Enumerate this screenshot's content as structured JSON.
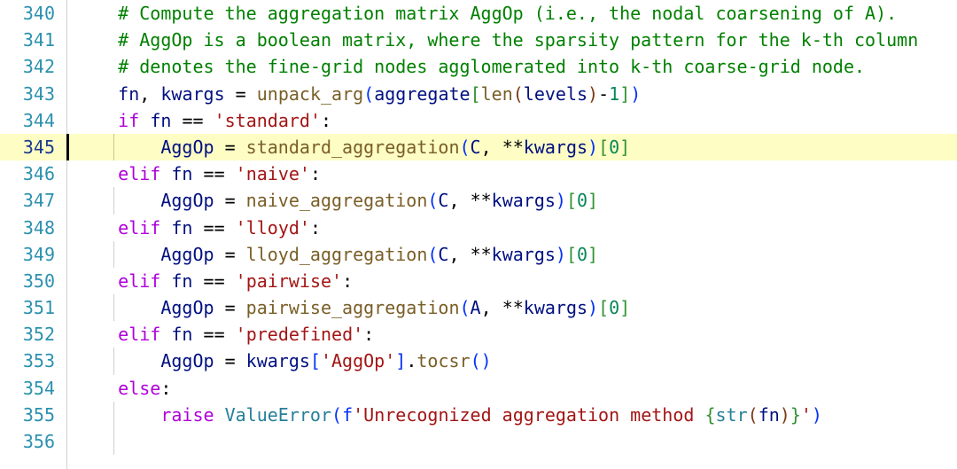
{
  "editor": {
    "name": "code-editor-pane",
    "language": "Python",
    "active_line": 345,
    "highlight_color": "#fdfdc4",
    "background_color": "#ffffff",
    "gutter_color": "#2b91af",
    "first_visible_line": 340,
    "last_visible_line": 356,
    "theme_colors": {
      "comment": "#008000",
      "keyword": "#af00db",
      "variable": "#001080",
      "function": "#795e26",
      "string": "#a31515",
      "number": "#098658",
      "class": "#267f99",
      "bracket_level_1": "#0431fa",
      "bracket_level_2": "#319331",
      "bracket_level_3": "#7b3814"
    }
  },
  "lines": [
    {
      "number": "340",
      "indent_guides": 0,
      "active": false,
      "text": "    # Compute the aggregation matrix AggOp (i.e., the nodal coarsening of A)."
    },
    {
      "number": "341",
      "indent_guides": 0,
      "active": false,
      "text": "    # AggOp is a boolean matrix, where the sparsity pattern for the k-th column"
    },
    {
      "number": "342",
      "indent_guides": 0,
      "active": false,
      "text": "    # denotes the fine-grid nodes agglomerated into k-th coarse-grid node."
    },
    {
      "number": "343",
      "indent_guides": 0,
      "active": false,
      "text": "    fn, kwargs = unpack_arg(aggregate[len(levels)-1])"
    },
    {
      "number": "344",
      "indent_guides": 0,
      "active": false,
      "text": "    if fn == 'standard':"
    },
    {
      "number": "345",
      "indent_guides": 1,
      "active": true,
      "text": "        AggOp = standard_aggregation(C, **kwargs)[0]"
    },
    {
      "number": "346",
      "indent_guides": 0,
      "active": false,
      "text": "    elif fn == 'naive':"
    },
    {
      "number": "347",
      "indent_guides": 1,
      "active": false,
      "text": "        AggOp = naive_aggregation(C, **kwargs)[0]"
    },
    {
      "number": "348",
      "indent_guides": 0,
      "active": false,
      "text": "    elif fn == 'lloyd':"
    },
    {
      "number": "349",
      "indent_guides": 1,
      "active": false,
      "text": "        AggOp = lloyd_aggregation(C, **kwargs)[0]"
    },
    {
      "number": "350",
      "indent_guides": 0,
      "active": false,
      "text": "    elif fn == 'pairwise':"
    },
    {
      "number": "351",
      "indent_guides": 1,
      "active": false,
      "text": "        AggOp = pairwise_aggregation(A, **kwargs)[0]"
    },
    {
      "number": "352",
      "indent_guides": 0,
      "active": false,
      "text": "    elif fn == 'predefined':"
    },
    {
      "number": "353",
      "indent_guides": 1,
      "active": false,
      "text": "        AggOp = kwargs['AggOp'].tocsr()"
    },
    {
      "number": "354",
      "indent_guides": 0,
      "active": false,
      "text": "    else:"
    },
    {
      "number": "355",
      "indent_guides": 1,
      "active": false,
      "text": "        raise ValueError(f'Unrecognized aggregation method {str(fn)}')"
    },
    {
      "number": "356",
      "indent_guides": 1,
      "active": false,
      "text": ""
    }
  ],
  "tokens": [
    [
      {
        "c": "t-com",
        "s": "    # Compute the aggregation matrix AggOp (i.e., the nodal coarsening of A)."
      }
    ],
    [
      {
        "c": "t-com",
        "s": "    # AggOp is a boolean matrix, where the sparsity pattern for the k-th column"
      }
    ],
    [
      {
        "c": "t-com",
        "s": "    # denotes the fine-grid nodes agglomerated into k-th coarse-grid node."
      }
    ],
    [
      {
        "c": "t-op",
        "s": "    "
      },
      {
        "c": "t-var",
        "s": "fn"
      },
      {
        "c": "t-op",
        "s": ", "
      },
      {
        "c": "t-var",
        "s": "kwargs"
      },
      {
        "c": "t-op",
        "s": " = "
      },
      {
        "c": "t-fn",
        "s": "unpack_arg"
      },
      {
        "c": "t-b1",
        "s": "("
      },
      {
        "c": "t-var",
        "s": "aggregate"
      },
      {
        "c": "t-b2",
        "s": "["
      },
      {
        "c": "t-fn",
        "s": "len"
      },
      {
        "c": "t-b3",
        "s": "("
      },
      {
        "c": "t-var",
        "s": "levels"
      },
      {
        "c": "t-b3",
        "s": ")"
      },
      {
        "c": "t-op",
        "s": "-"
      },
      {
        "c": "t-num",
        "s": "1"
      },
      {
        "c": "t-b2",
        "s": "]"
      },
      {
        "c": "t-b1",
        "s": ")"
      }
    ],
    [
      {
        "c": "t-op",
        "s": "    "
      },
      {
        "c": "t-kw",
        "s": "if"
      },
      {
        "c": "t-op",
        "s": " "
      },
      {
        "c": "t-var",
        "s": "fn"
      },
      {
        "c": "t-op",
        "s": " == "
      },
      {
        "c": "t-str",
        "s": "'standard'"
      },
      {
        "c": "t-op",
        "s": ":"
      }
    ],
    [
      {
        "c": "t-op",
        "s": "        "
      },
      {
        "c": "t-var",
        "s": "AggOp"
      },
      {
        "c": "t-op",
        "s": " = "
      },
      {
        "c": "t-fn",
        "s": "standard_aggregation"
      },
      {
        "c": "t-b1",
        "s": "("
      },
      {
        "c": "t-var",
        "s": "C"
      },
      {
        "c": "t-op",
        "s": ", "
      },
      {
        "c": "t-op",
        "s": "**"
      },
      {
        "c": "t-var",
        "s": "kwargs"
      },
      {
        "c": "t-b1",
        "s": ")"
      },
      {
        "c": "t-b2",
        "s": "["
      },
      {
        "c": "t-num",
        "s": "0"
      },
      {
        "c": "t-b2",
        "s": "]"
      }
    ],
    [
      {
        "c": "t-op",
        "s": "    "
      },
      {
        "c": "t-kw",
        "s": "elif"
      },
      {
        "c": "t-op",
        "s": " "
      },
      {
        "c": "t-var",
        "s": "fn"
      },
      {
        "c": "t-op",
        "s": " == "
      },
      {
        "c": "t-str",
        "s": "'naive'"
      },
      {
        "c": "t-op",
        "s": ":"
      }
    ],
    [
      {
        "c": "t-op",
        "s": "        "
      },
      {
        "c": "t-var",
        "s": "AggOp"
      },
      {
        "c": "t-op",
        "s": " = "
      },
      {
        "c": "t-fn",
        "s": "naive_aggregation"
      },
      {
        "c": "t-b1",
        "s": "("
      },
      {
        "c": "t-var",
        "s": "C"
      },
      {
        "c": "t-op",
        "s": ", "
      },
      {
        "c": "t-op",
        "s": "**"
      },
      {
        "c": "t-var",
        "s": "kwargs"
      },
      {
        "c": "t-b1",
        "s": ")"
      },
      {
        "c": "t-b2",
        "s": "["
      },
      {
        "c": "t-num",
        "s": "0"
      },
      {
        "c": "t-b2",
        "s": "]"
      }
    ],
    [
      {
        "c": "t-op",
        "s": "    "
      },
      {
        "c": "t-kw",
        "s": "elif"
      },
      {
        "c": "t-op",
        "s": " "
      },
      {
        "c": "t-var",
        "s": "fn"
      },
      {
        "c": "t-op",
        "s": " == "
      },
      {
        "c": "t-str",
        "s": "'lloyd'"
      },
      {
        "c": "t-op",
        "s": ":"
      }
    ],
    [
      {
        "c": "t-op",
        "s": "        "
      },
      {
        "c": "t-var",
        "s": "AggOp"
      },
      {
        "c": "t-op",
        "s": " = "
      },
      {
        "c": "t-fn",
        "s": "lloyd_aggregation"
      },
      {
        "c": "t-b1",
        "s": "("
      },
      {
        "c": "t-var",
        "s": "C"
      },
      {
        "c": "t-op",
        "s": ", "
      },
      {
        "c": "t-op",
        "s": "**"
      },
      {
        "c": "t-var",
        "s": "kwargs"
      },
      {
        "c": "t-b1",
        "s": ")"
      },
      {
        "c": "t-b2",
        "s": "["
      },
      {
        "c": "t-num",
        "s": "0"
      },
      {
        "c": "t-b2",
        "s": "]"
      }
    ],
    [
      {
        "c": "t-op",
        "s": "    "
      },
      {
        "c": "t-kw",
        "s": "elif"
      },
      {
        "c": "t-op",
        "s": " "
      },
      {
        "c": "t-var",
        "s": "fn"
      },
      {
        "c": "t-op",
        "s": " == "
      },
      {
        "c": "t-str",
        "s": "'pairwise'"
      },
      {
        "c": "t-op",
        "s": ":"
      }
    ],
    [
      {
        "c": "t-op",
        "s": "        "
      },
      {
        "c": "t-var",
        "s": "AggOp"
      },
      {
        "c": "t-op",
        "s": " = "
      },
      {
        "c": "t-fn",
        "s": "pairwise_aggregation"
      },
      {
        "c": "t-b1",
        "s": "("
      },
      {
        "c": "t-var",
        "s": "A"
      },
      {
        "c": "t-op",
        "s": ", "
      },
      {
        "c": "t-op",
        "s": "**"
      },
      {
        "c": "t-var",
        "s": "kwargs"
      },
      {
        "c": "t-b1",
        "s": ")"
      },
      {
        "c": "t-b2",
        "s": "["
      },
      {
        "c": "t-num",
        "s": "0"
      },
      {
        "c": "t-b2",
        "s": "]"
      }
    ],
    [
      {
        "c": "t-op",
        "s": "    "
      },
      {
        "c": "t-kw",
        "s": "elif"
      },
      {
        "c": "t-op",
        "s": " "
      },
      {
        "c": "t-var",
        "s": "fn"
      },
      {
        "c": "t-op",
        "s": " == "
      },
      {
        "c": "t-str",
        "s": "'predefined'"
      },
      {
        "c": "t-op",
        "s": ":"
      }
    ],
    [
      {
        "c": "t-op",
        "s": "        "
      },
      {
        "c": "t-var",
        "s": "AggOp"
      },
      {
        "c": "t-op",
        "s": " = "
      },
      {
        "c": "t-var",
        "s": "kwargs"
      },
      {
        "c": "t-b1",
        "s": "["
      },
      {
        "c": "t-str",
        "s": "'AggOp'"
      },
      {
        "c": "t-b1",
        "s": "]"
      },
      {
        "c": "t-op",
        "s": "."
      },
      {
        "c": "t-fn",
        "s": "tocsr"
      },
      {
        "c": "t-b1",
        "s": "()"
      }
    ],
    [
      {
        "c": "t-op",
        "s": "    "
      },
      {
        "c": "t-kw",
        "s": "else"
      },
      {
        "c": "t-op",
        "s": ":"
      }
    ],
    [
      {
        "c": "t-op",
        "s": "        "
      },
      {
        "c": "t-kw",
        "s": "raise"
      },
      {
        "c": "t-op",
        "s": " "
      },
      {
        "c": "t-cls",
        "s": "ValueError"
      },
      {
        "c": "t-b1",
        "s": "("
      },
      {
        "c": "t-b1",
        "s": "f"
      },
      {
        "c": "t-str",
        "s": "'Unrecognized aggregation method "
      },
      {
        "c": "t-b2",
        "s": "{"
      },
      {
        "c": "t-cls",
        "s": "str"
      },
      {
        "c": "t-b3",
        "s": "("
      },
      {
        "c": "t-var",
        "s": "fn"
      },
      {
        "c": "t-b3",
        "s": ")"
      },
      {
        "c": "t-b2",
        "s": "}"
      },
      {
        "c": "t-str",
        "s": "'"
      },
      {
        "c": "t-b1",
        "s": ")"
      }
    ],
    []
  ]
}
